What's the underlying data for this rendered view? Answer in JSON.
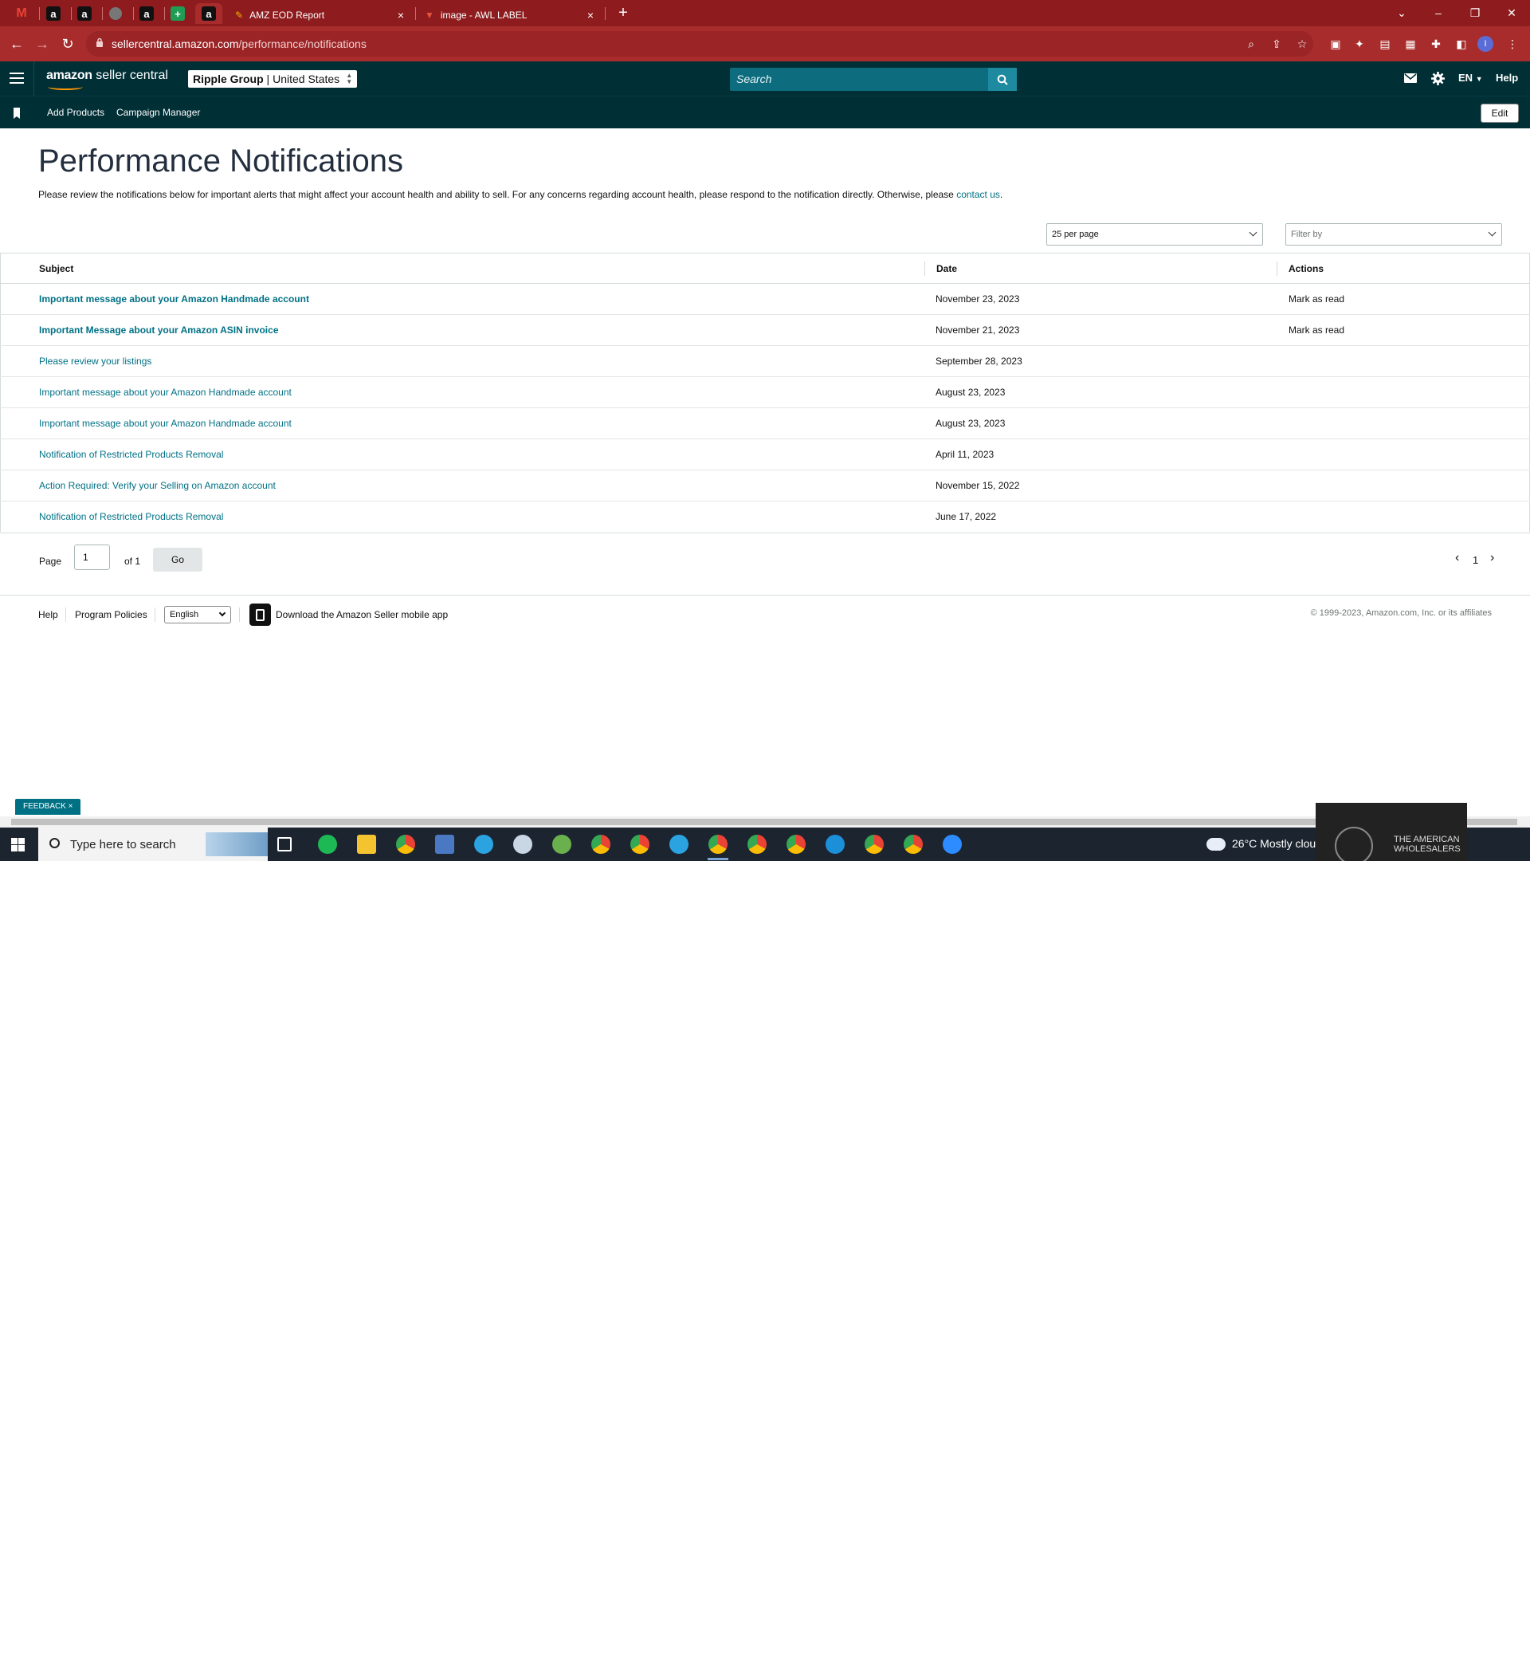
{
  "browser": {
    "tabs": [
      {
        "title": "AMZ EOD Report",
        "close": "×"
      },
      {
        "title": "image - AWL LABEL",
        "close": "×"
      }
    ],
    "new_tab": "+",
    "url_host": "sellercentral.amazon.com",
    "url_path": "/performance/notifications",
    "window_controls": [
      "⌄",
      "–",
      "❐",
      "✕"
    ]
  },
  "header": {
    "logo_bold": "amazon",
    "logo_rest": " seller central",
    "account_name": "Ripple Group",
    "account_region": "United States",
    "search_placeholder": "Search",
    "lang": "EN",
    "help": "Help"
  },
  "subnav": {
    "items": [
      "Add Products",
      "Campaign Manager"
    ],
    "edit": "Edit"
  },
  "page": {
    "title": "Performance Notifications",
    "intro": "Please review the notifications below for important alerts that might affect your account health and ability to sell. For any concerns regarding account health, please respond to the notification directly. Otherwise, please ",
    "intro_link": "contact us",
    "intro_end": ".",
    "per_page": "25 per page",
    "filter": "Filter by"
  },
  "table": {
    "columns": [
      "Subject",
      "Date",
      "Actions"
    ],
    "rows": [
      {
        "subject": "Important message about your Amazon Handmade account",
        "date": "November 23, 2023",
        "action": "Mark as read",
        "unread": true
      },
      {
        "subject": "Important Message about your Amazon ASIN invoice",
        "date": "November 21, 2023",
        "action": "Mark as read",
        "unread": true
      },
      {
        "subject": "Please review your listings",
        "date": "September 28, 2023",
        "action": "",
        "unread": false
      },
      {
        "subject": "Important message about your Amazon Handmade account",
        "date": "August 23, 2023",
        "action": "",
        "unread": false
      },
      {
        "subject": "Important message about your Amazon Handmade account",
        "date": "August 23, 2023",
        "action": "",
        "unread": false
      },
      {
        "subject": "Notification of Restricted Products Removal",
        "date": "April 11, 2023",
        "action": "",
        "unread": false
      },
      {
        "subject": "Action Required: Verify your Selling on Amazon account",
        "date": "November 15, 2022",
        "action": "",
        "unread": false
      },
      {
        "subject": "Notification of Restricted Products Removal",
        "date": "June 17, 2022",
        "action": "",
        "unread": false
      }
    ]
  },
  "pagination": {
    "page_label": "Page",
    "page_value": "1",
    "of_label": "of 1",
    "go": "Go",
    "current": "1",
    "prev": "‹",
    "next": "›"
  },
  "footer": {
    "help": "Help",
    "policies": "Program Policies",
    "language": "English",
    "app": "Download the Amazon Seller mobile app",
    "copyright": "© 1999-2023, Amazon.com, Inc. or its affiliates"
  },
  "feedback": "FEEDBACK ×",
  "taskbar": {
    "search_placeholder": "Type here to search",
    "weather": "26°C  Mostly clou",
    "promo_text": "THE AMERICAN WHOLESALERS"
  },
  "colors": {
    "browser_frame": "#8e1c1e",
    "amazon_header": "#002f36",
    "link": "#007185",
    "search": "#0d6c7e"
  }
}
